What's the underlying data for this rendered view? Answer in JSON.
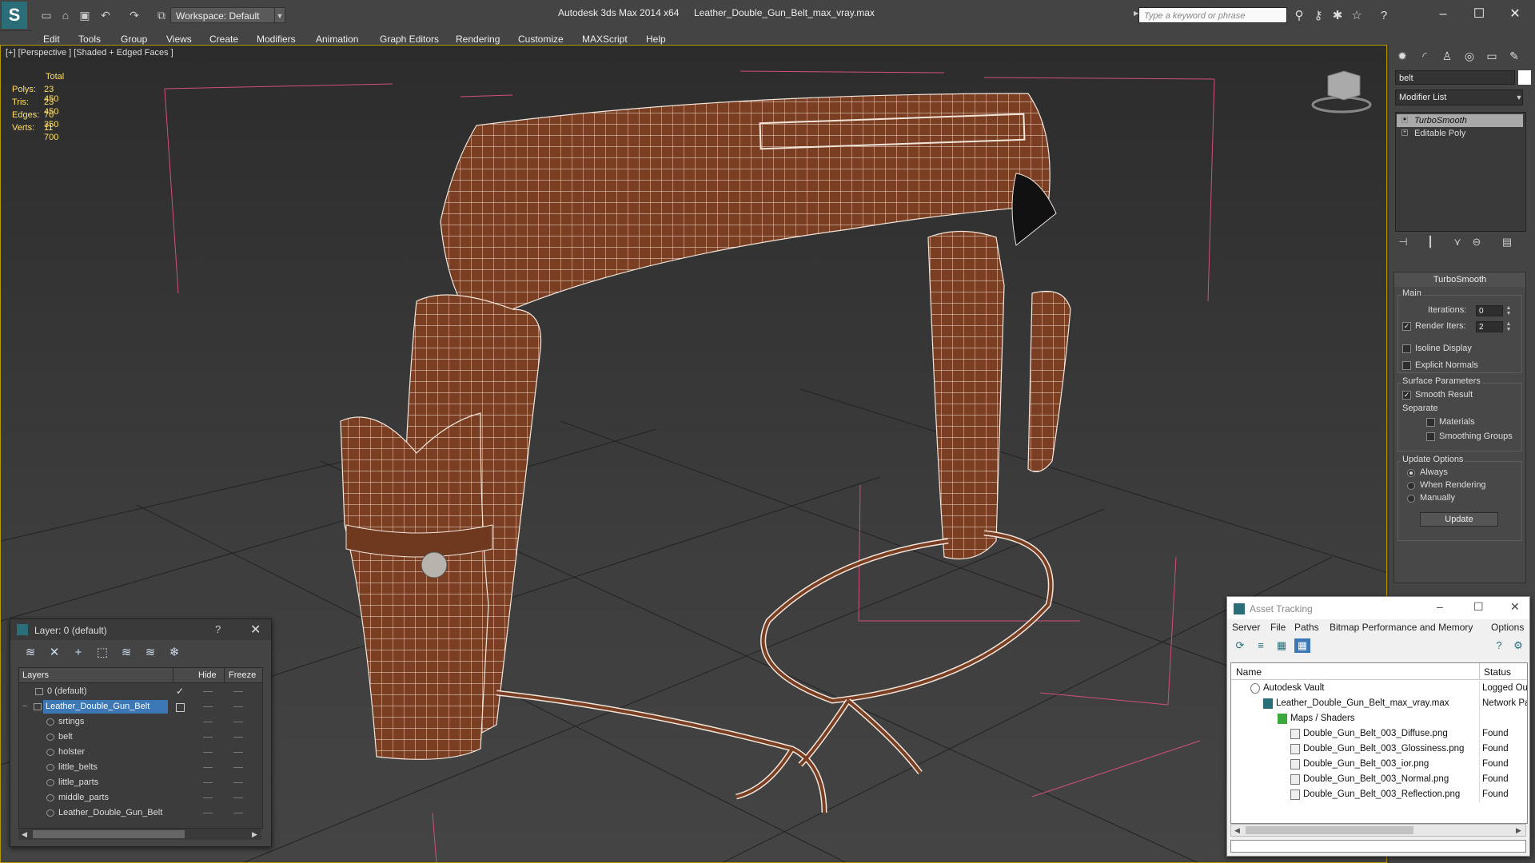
{
  "titlebar": {
    "app_title": "Autodesk 3ds Max  2014 x64",
    "file_name": "Leather_Double_Gun_Belt_max_vray.max",
    "workspace_label": "Workspace: Default",
    "search_placeholder": "Type a keyword or phrase",
    "logo_glyph": "S"
  },
  "menu": {
    "items": [
      "Edit",
      "Tools",
      "Group",
      "Views",
      "Create",
      "Modifiers",
      "Animation",
      "Graph Editors",
      "Rendering",
      "Customize",
      "MAXScript",
      "Help"
    ]
  },
  "viewport": {
    "label": "[+] [Perspective ] [Shaded + Edged Faces ]",
    "stats": {
      "header": "Total",
      "rows": [
        {
          "label": "Polys:",
          "value": "23 450"
        },
        {
          "label": "Tris:",
          "value": "23 450"
        },
        {
          "label": "Edges:",
          "value": "70 350"
        },
        {
          "label": "Verts:",
          "value": "11 700"
        }
      ]
    },
    "accent_color": "#b69700",
    "stats_color": "#ffe066"
  },
  "command_panel": {
    "object_name": "belt",
    "modifier_list_label": "Modifier List",
    "stack": [
      {
        "label": "TurboSmooth",
        "italic": true,
        "selected": true
      },
      {
        "label": "Editable Poly",
        "italic": false,
        "selected": false
      }
    ],
    "turbosmooth": {
      "title": "TurboSmooth",
      "main_label": "Main",
      "iterations_label": "Iterations:",
      "iterations_value": "0",
      "render_iters_label": "Render Iters:",
      "render_iters_value": "2",
      "render_iters_checked": true,
      "isoline_label": "Isoline Display",
      "explicit_normals_label": "Explicit Normals",
      "surface_params_label": "Surface Parameters",
      "smooth_result_label": "Smooth Result",
      "separate_label": "Separate",
      "materials_label": "Materials",
      "smoothing_groups_label": "Smoothing Groups",
      "update_options_label": "Update Options",
      "always_label": "Always",
      "when_rendering_label": "When Rendering",
      "manually_label": "Manually",
      "update_button": "Update"
    }
  },
  "layer_window": {
    "title": "Layer: 0 (default)",
    "help": "?",
    "columns": {
      "layers": "Layers",
      "hide": "Hide",
      "freeze": "Freeze"
    },
    "rows": [
      {
        "name": "0 (default)",
        "indent": 0,
        "checked": true,
        "selected": false
      },
      {
        "name": "Leather_Double_Gun_Belt",
        "indent": 0,
        "checked": false,
        "selected": true
      },
      {
        "name": "srtings",
        "indent": 1,
        "checked": false,
        "selected": false
      },
      {
        "name": "belt",
        "indent": 1,
        "checked": false,
        "selected": false
      },
      {
        "name": "holster",
        "indent": 1,
        "checked": false,
        "selected": false
      },
      {
        "name": "little_belts",
        "indent": 1,
        "checked": false,
        "selected": false
      },
      {
        "name": "little_parts",
        "indent": 1,
        "checked": false,
        "selected": false
      },
      {
        "name": "middle_parts",
        "indent": 1,
        "checked": false,
        "selected": false
      },
      {
        "name": "Leather_Double_Gun_Belt",
        "indent": 1,
        "checked": false,
        "selected": false
      }
    ]
  },
  "asset_window": {
    "title": "Asset Tracking",
    "menu": [
      "Server",
      "File",
      "Paths",
      "Bitmap Performance and Memory",
      "Options"
    ],
    "columns": {
      "name": "Name",
      "status": "Status"
    },
    "rows": [
      {
        "name": "Autodesk Vault",
        "status": "Logged Ou",
        "indent": 1,
        "icon": "vault-icon"
      },
      {
        "name": "Leather_Double_Gun_Belt_max_vray.max",
        "status": "Network Pa",
        "indent": 2,
        "icon": "max-file-icon"
      },
      {
        "name": "Maps / Shaders",
        "status": "",
        "indent": 3,
        "icon": "maps-folder-icon"
      },
      {
        "name": "Double_Gun_Belt_003_Diffuse.png",
        "status": "Found",
        "indent": 4,
        "icon": "image-file-icon"
      },
      {
        "name": "Double_Gun_Belt_003_Glossiness.png",
        "status": "Found",
        "indent": 4,
        "icon": "image-file-icon"
      },
      {
        "name": "Double_Gun_Belt_003_ior.png",
        "status": "Found",
        "indent": 4,
        "icon": "image-file-icon"
      },
      {
        "name": "Double_Gun_Belt_003_Normal.png",
        "status": "Found",
        "indent": 4,
        "icon": "image-file-icon"
      },
      {
        "name": "Double_Gun_Belt_003_Reflection.png",
        "status": "Found",
        "indent": 4,
        "icon": "image-file-icon"
      }
    ]
  }
}
